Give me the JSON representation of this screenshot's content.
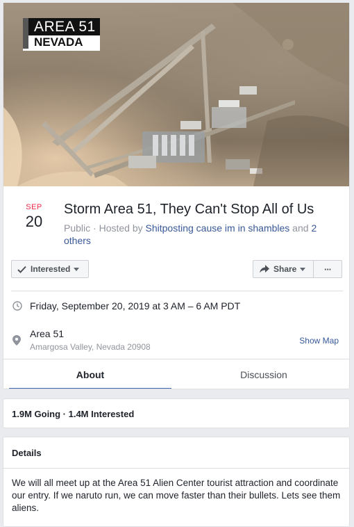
{
  "cover": {
    "overlay_line1": "AREA 51",
    "overlay_line2": "NEVADA"
  },
  "event": {
    "month": "SEP",
    "day": "20",
    "title": "Storm Area 51, They Can't Stop All of Us",
    "privacy": "Public",
    "hosted_prefix": " · Hosted by ",
    "host": "Shitposting cause im in shambles",
    "and_text": " and ",
    "others": "2 others"
  },
  "actions": {
    "interested_label": "Interested",
    "share_label": "Share",
    "more_label": "···"
  },
  "info": {
    "datetime": "Friday, September 20, 2019 at 3 AM – 6 AM PDT",
    "location_name": "Area 51",
    "location_address": "Amargosa Valley, Nevada 20908",
    "show_map": "Show Map"
  },
  "tabs": [
    {
      "label": "About",
      "active": true
    },
    {
      "label": "Discussion",
      "active": false
    }
  ],
  "stats": {
    "text": "1.9M Going · 1.4M Interested"
  },
  "details": {
    "heading": "Details",
    "body": "We will all meet up at the Area 51 Alien Center tourist attraction and coordinate our entry. If we naruto run, we can move faster than their bullets. Lets see them aliens."
  },
  "colors": {
    "link": "#385898",
    "month": "#f02849",
    "tab_underline": "#4267b2",
    "page_bg": "#e9ebee"
  },
  "icons": [
    "check-icon",
    "share-arrow-icon",
    "more-dots-icon",
    "clock-icon",
    "location-pin-icon"
  ]
}
